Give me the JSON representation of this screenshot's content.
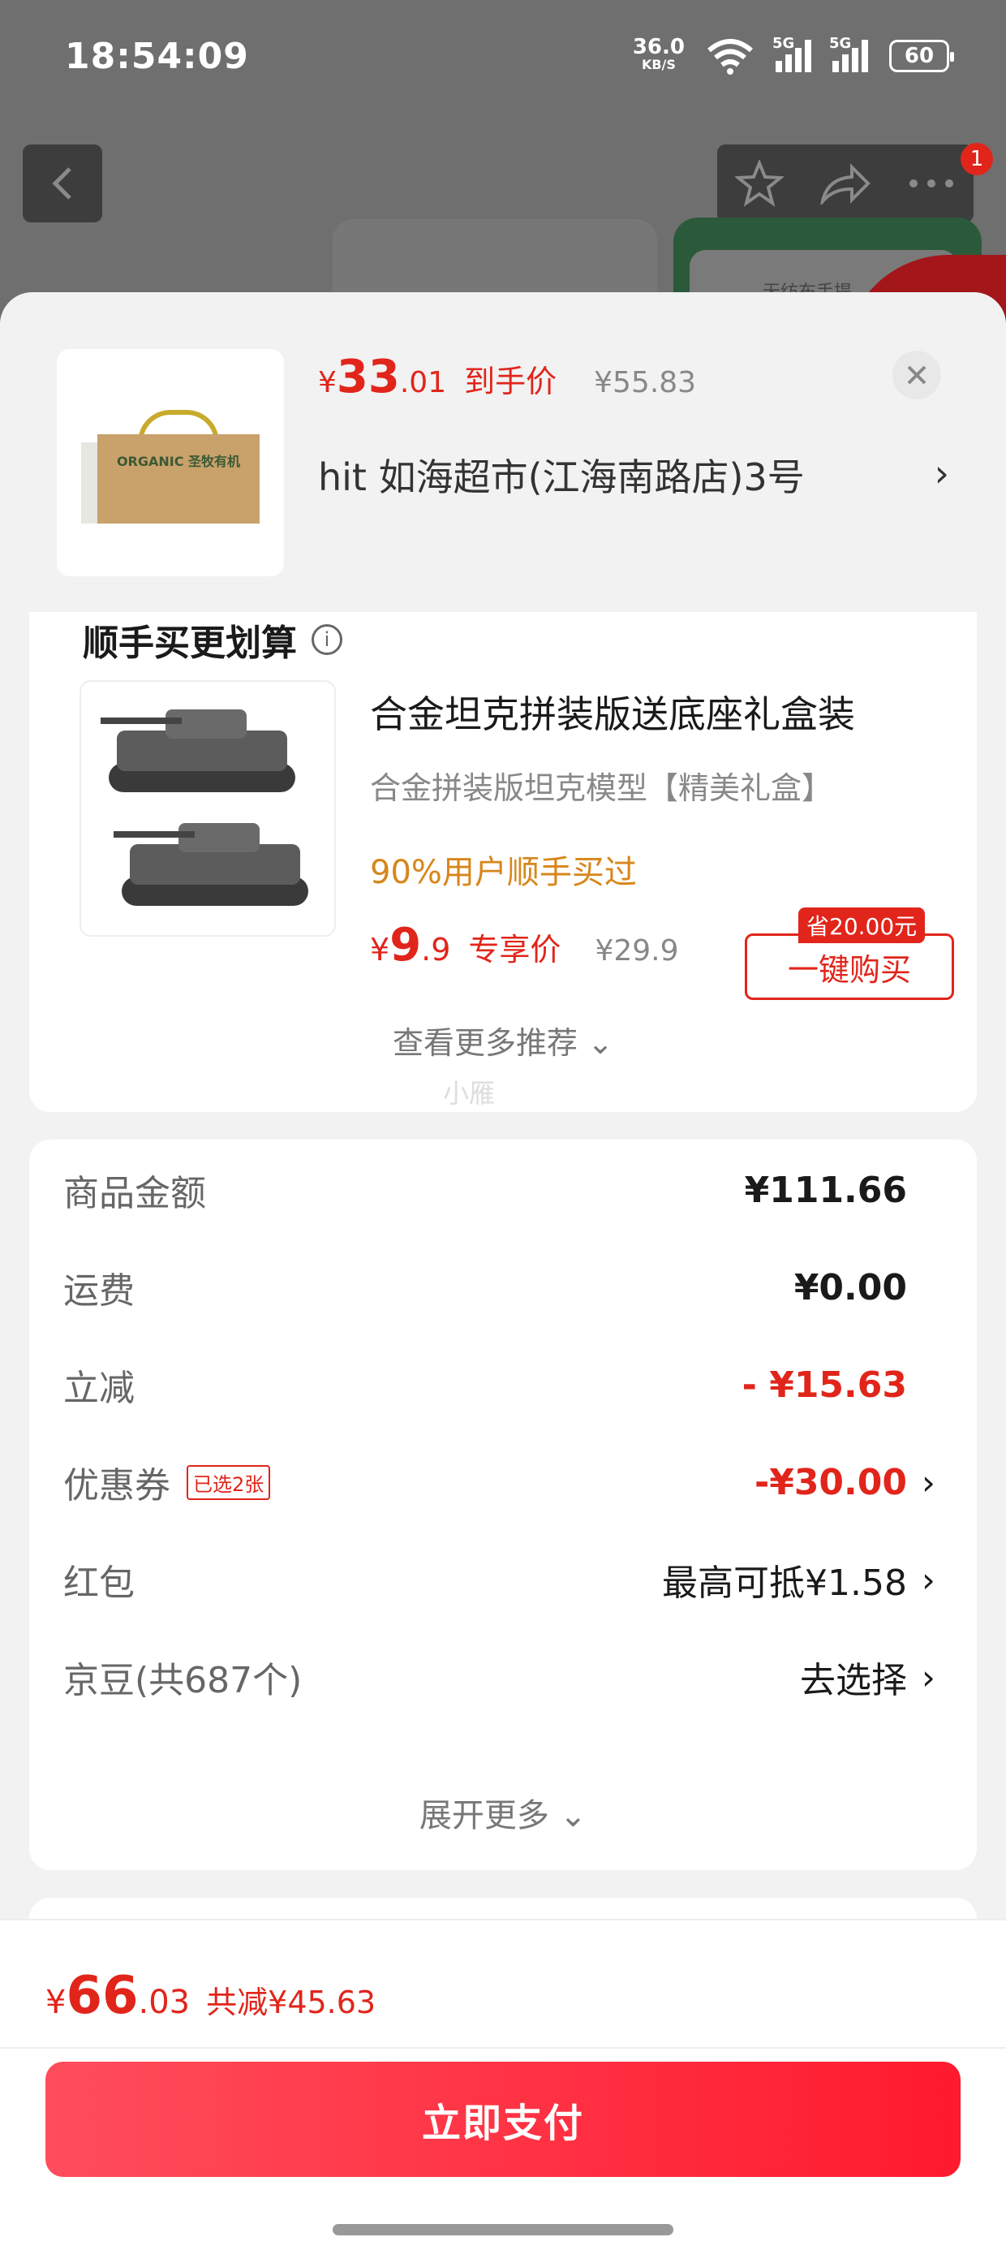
{
  "status_bar": {
    "time": "18:54:09",
    "net_speed": "36.0",
    "net_unit": "KB/S",
    "sim1": "5G",
    "sim2": "5G",
    "battery": "60"
  },
  "background_nav": {
    "badge_count": "1",
    "bg_card_text": "无纺布手提"
  },
  "product": {
    "price_yen": "¥",
    "price_int": "33",
    "price_dec": ".01",
    "price_tag": "到手价",
    "original_price": "¥55.83",
    "store": "hit 如海超市(江海南路店)3号",
    "image_brand": "ORGANIC 圣牧有机"
  },
  "recommend": {
    "title": "顺手买更划算",
    "item": {
      "name": "合金坦克拼装版送底座礼盒装",
      "subtitle": "合金拼装版坦克模型【精美礼盒】",
      "percent": "90%用户顺手买过",
      "price_yen": "¥",
      "price_int": "9",
      "price_dec": ".9",
      "price_tag": "专享价",
      "original_price": "¥29.9",
      "save_tag": "省20.00元",
      "buy_label": "一键购买"
    },
    "more_label": "查看更多推荐 ⌄",
    "watermark": "小雁"
  },
  "costs": {
    "rows": [
      {
        "label": "商品金额",
        "value": "¥111.66"
      },
      {
        "label": "运费",
        "value": "¥0.00"
      },
      {
        "label": "立减",
        "value": "- ¥15.63"
      },
      {
        "label": "优惠券",
        "chip": "已选2张",
        "value": "-¥30.00"
      },
      {
        "label": "红包",
        "value": "最高可抵¥1.58"
      },
      {
        "label": "京豆(共687个)",
        "value": "去选择"
      }
    ],
    "expand_label": "展开更多 ⌄"
  },
  "footer": {
    "total_yen": "¥",
    "total_int": "66",
    "total_dec": ".03",
    "saved": "共减¥45.63",
    "pay_label": "立即支付"
  },
  "colors": {
    "accent": "#e1251b",
    "orange": "#d8861a",
    "pay_gradient_start": "#ff4d5c",
    "pay_gradient_end": "#ff1a2e"
  }
}
